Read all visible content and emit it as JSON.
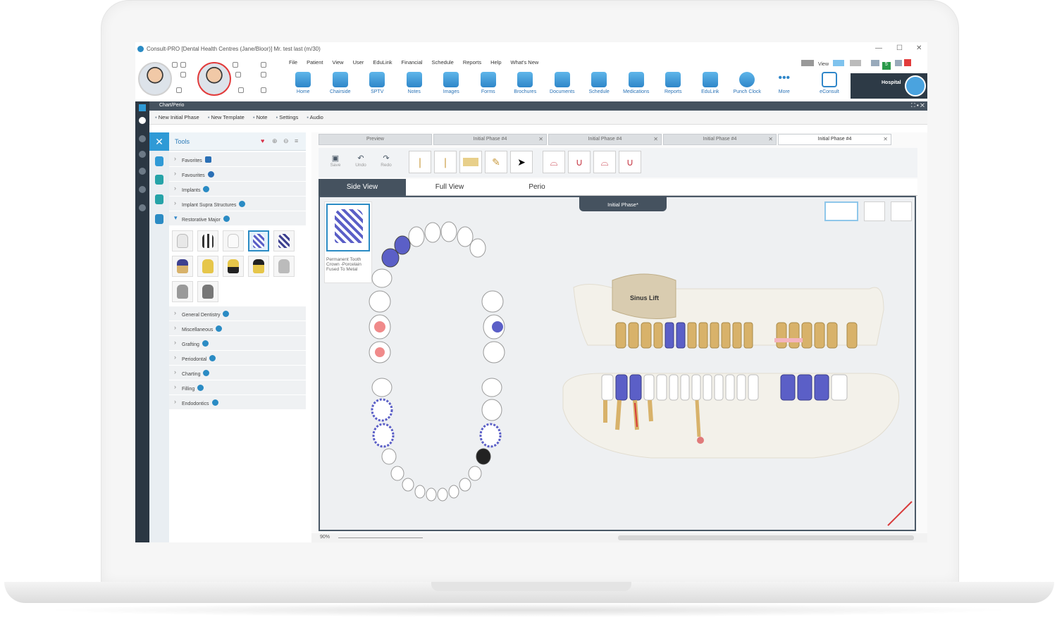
{
  "window": {
    "title": "Consult-PRO [Dental Health Centres (Jane/Bloor)]  Mr. test last (m/30)",
    "controls": [
      "—",
      "☐",
      "✕"
    ]
  },
  "menu": [
    "File",
    "Patient",
    "View",
    "User",
    "EduLink",
    "Financial",
    "Schedule",
    "Reports",
    "Help",
    "What's New"
  ],
  "toolbar": [
    "Home",
    "Chairside",
    "SPTV",
    "Notes",
    "Images",
    "Forms",
    "Brochures",
    "Documents",
    "Schedule",
    "Medications",
    "Reports",
    "EduLink",
    "Punch Clock",
    "More"
  ],
  "econsult": "eConsult",
  "hospital": "Hospital",
  "view_label": "View",
  "view_badge": "5",
  "subbar_title": "Chart/Perio",
  "actions": [
    "New Initial Phase",
    "New Template",
    "Note",
    "Settings",
    "Audio"
  ],
  "tools": {
    "title": "Tools",
    "categories_top": [
      "Favorites",
      "Favourites",
      "Implants",
      "Implant Supra Structures",
      "Restorative Major"
    ],
    "categories_bottom": [
      "General Dentistry",
      "Miscellaneous",
      "Grafting",
      "Periodontal",
      "Charting",
      "Filling",
      "Endodontics"
    ]
  },
  "doc_tabs": [
    "Preview",
    "Initial Phase #4",
    "Initial Phase #4",
    "Initial Phase #4",
    "Initial Phase #4"
  ],
  "edit_tools": [
    "Save",
    "Undo",
    "Redo"
  ],
  "view_tabs": [
    "Side View",
    "Full View",
    "Perio"
  ],
  "phase_title": "Initial Phase*",
  "selected_item": "Permanent Tooth Crown -Porcelain Fused To Metal",
  "sinus_lift": "Sinus Lift",
  "zoom": "90%",
  "colors": {
    "accent": "#2a8bc4",
    "dark_panel": "#45525f",
    "crown_stripe": "#5b5fc7",
    "tooth_root": "#d8b26a"
  }
}
